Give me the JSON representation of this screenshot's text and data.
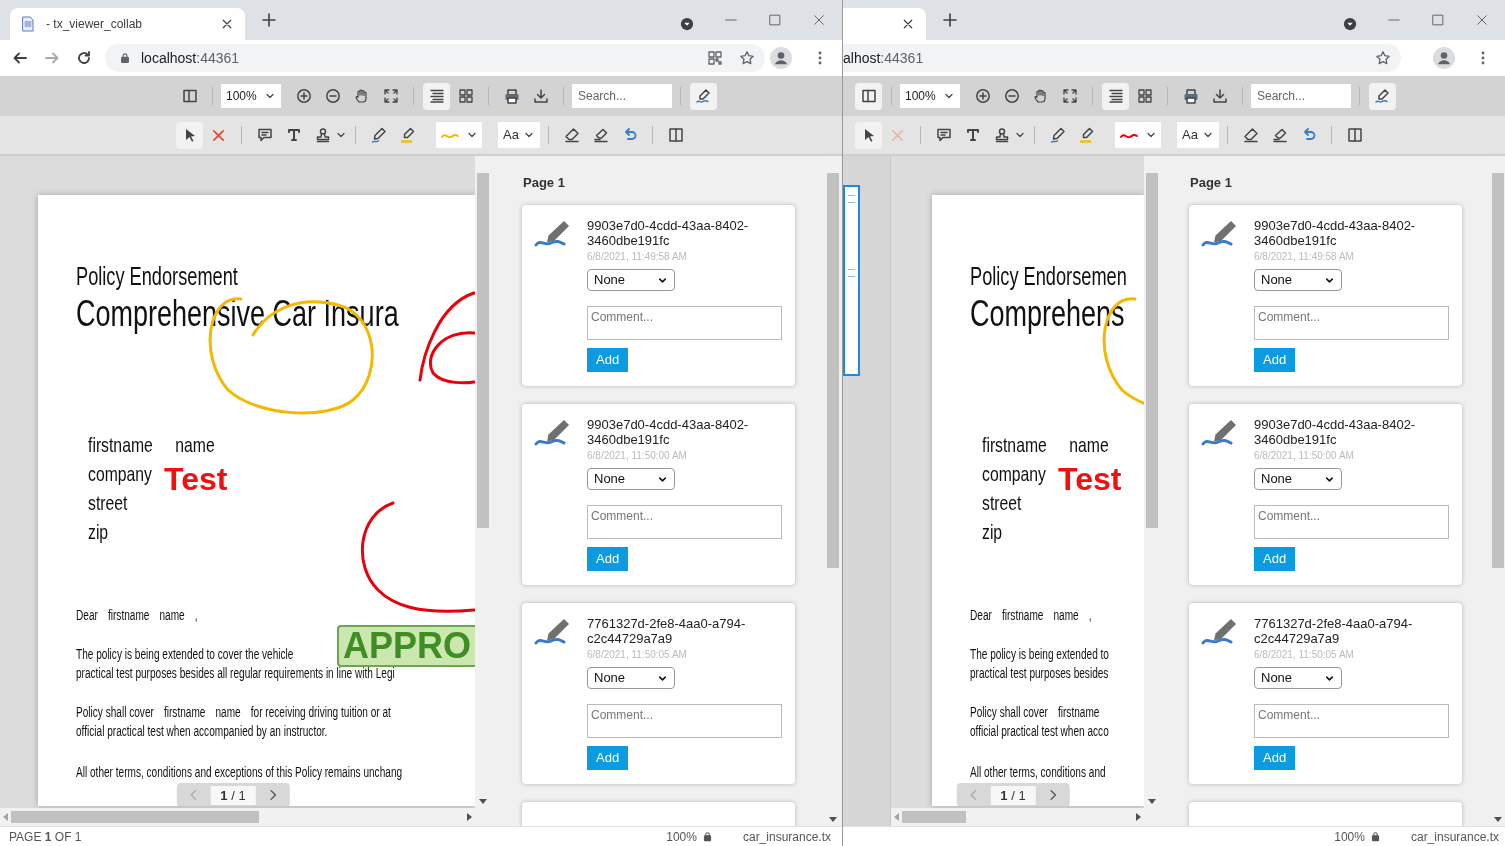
{
  "windows": [
    {
      "tab": {
        "title": "- tx_viewer_collab"
      },
      "address": {
        "host": "localhost",
        "port": ":44361"
      },
      "toolbar": {
        "sidebar_selected": false,
        "zoom": "100%",
        "search_placeholder": "Search...",
        "delete_disabled": false,
        "stroke_picker": {
          "color": "#f5b800"
        },
        "font_label": "Aa"
      },
      "document": {
        "heading": "Policy Endorsement",
        "title": "Comprehensive Car Insura",
        "address_lines": [
          [
            "firstname",
            "name"
          ],
          [
            "company"
          ],
          [
            "street"
          ],
          [
            "zip"
          ]
        ],
        "salutation": [
          "Dear",
          "firstname",
          "name",
          ","
        ],
        "paragraphs": [
          [
            [
              "The policy is being extended to cover the vehicle"
            ],
            [
              "practical test purposes besides all regular requirements in line with Legi"
            ]
          ],
          [
            [
              "Policy shall cover",
              "firstname",
              "name",
              "for receiving driving tuition or at"
            ],
            [
              "official practical test when accompanied by an instructor."
            ]
          ],
          [
            [
              "All other terms, conditions and exceptions of this Policy remains unchang"
            ]
          ]
        ],
        "text_annotation": "Test",
        "stamp": "APPRO",
        "strokes": [
          {
            "kind": "loop",
            "color": "#f5b800"
          },
          {
            "kind": "hook",
            "color": "#e8000b"
          },
          {
            "kind": "arc",
            "color": "#e8000b"
          }
        ],
        "page_indicator": "**1** / 1"
      },
      "comments_panel": {
        "heading": "Page 1",
        "comments": [
          {
            "kind": "card",
            "id": "9903e7d0-4cdd-43aa-8402-3460dbe191fc",
            "date": "6/8/2021, 11:49:58 AM",
            "status": "None",
            "placeholder": "Comment...",
            "button": "Add"
          },
          {
            "kind": "card",
            "id": "9903e7d0-4cdd-43aa-8402-3460dbe191fc",
            "date": "6/8/2021, 11:50:00 AM",
            "status": "None",
            "placeholder": "Comment...",
            "button": "Add"
          },
          {
            "kind": "card",
            "id": "7761327d-2fe8-4aa0-a794-c2c44729a7a9",
            "date": "6/8/2021, 11:50:05 AM",
            "status": "None",
            "placeholder": "Comment...",
            "button": "Add"
          },
          {
            "kind": "cut"
          }
        ]
      },
      "status_bar": {
        "page": "PAGE **1** OF 1",
        "zoom": "100%",
        "file": "car_insurance.tx"
      }
    },
    {
      "address": {
        "host": "alhost",
        "port": ":44361"
      },
      "toolbar": {
        "sidebar_selected": true,
        "zoom": "100%",
        "search_placeholder": "Search...",
        "delete_disabled": true,
        "stroke_picker": {
          "color": "#e8000b"
        },
        "font_label": "Aa"
      },
      "document": {
        "heading": "Policy Endorsemen",
        "title": "Comprehens",
        "address_lines": [
          [
            "firstname",
            "name"
          ],
          [
            "company"
          ],
          [
            "street"
          ],
          [
            "zip"
          ]
        ],
        "salutation": [
          "Dear",
          "firstname",
          "name",
          ","
        ],
        "paragraphs": [
          [
            [
              "The policy is being extended to"
            ],
            [
              "practical test purposes besides"
            ]
          ],
          [
            [
              "Policy shall cover",
              "firstname"
            ],
            [
              "official practical test when acco"
            ]
          ],
          [
            [
              "All other terms, conditions and"
            ]
          ]
        ],
        "text_annotation": "Test",
        "strokes": [
          {
            "kind": "loop",
            "color": "#f5b800"
          }
        ],
        "page_indicator": "**1** / 1"
      },
      "comments_panel": {
        "heading": "Page 1",
        "comments": [
          {
            "kind": "card",
            "id": "9903e7d0-4cdd-43aa-8402-3460dbe191fc",
            "date": "6/8/2021, 11:49:58 AM",
            "status": "None",
            "placeholder": "Comment...",
            "button": "Add"
          },
          {
            "kind": "card",
            "id": "9903e7d0-4cdd-43aa-8402-3460dbe191fc",
            "date": "6/8/2021, 11:50:00 AM",
            "status": "None",
            "placeholder": "Comment...",
            "button": "Add"
          },
          {
            "kind": "card",
            "id": "7761327d-2fe8-4aa0-a794-c2c44729a7a9",
            "date": "6/8/2021, 11:50:05 AM",
            "status": "None",
            "placeholder": "Comment...",
            "button": "Add"
          },
          {
            "kind": "cut"
          }
        ]
      },
      "status_bar": {
        "zoom": "100%",
        "file": "car_insurance.tx"
      }
    }
  ]
}
